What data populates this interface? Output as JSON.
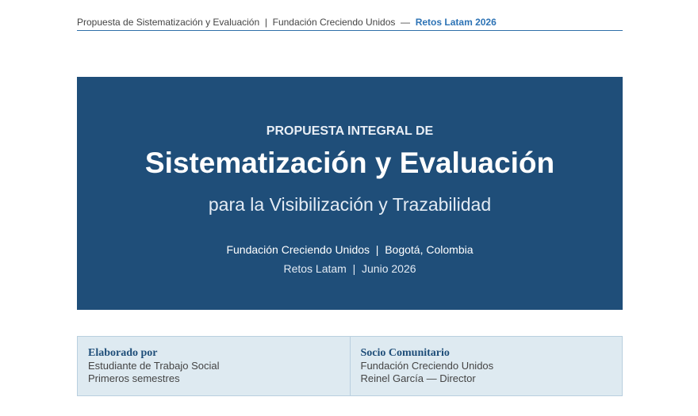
{
  "header": {
    "doc_title": "Propuesta de Sistematización y Evaluación",
    "separator": "|",
    "organization": "Fundación Creciendo Unidos",
    "dash": "—",
    "program": "Retos Latam 2026",
    "rule_color": "#2f6fa8"
  },
  "banner": {
    "kicker": "PROPUESTA INTEGRAL DE",
    "title": "Sistematización y Evaluación",
    "subtitle": "para la Visibilización y Trazabilidad",
    "org_line": "Fundación Creciendo Unidos  |  Bogotá, Colombia",
    "date_line": "Retos Latam  |  Junio 2026",
    "background": "#1f4e79"
  },
  "info": {
    "left": {
      "heading": "Elaborado por",
      "line1": "Estudiante de Trabajo Social",
      "line2": "Primeros semestres"
    },
    "right": {
      "heading": "Socio Comunitario",
      "line1": "Fundación Creciendo Unidos",
      "line2": "Reinel García — Director"
    },
    "background": "#deeaf1"
  }
}
